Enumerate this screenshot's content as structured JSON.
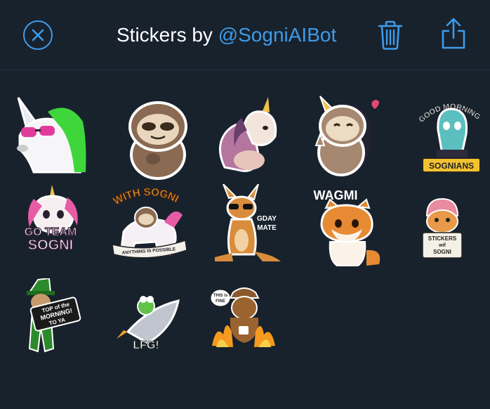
{
  "header": {
    "title_prefix": "Stickers by ",
    "title_handle": "@SogniAIBot",
    "close_icon": "close-circle-icon",
    "trash_icon": "trash-icon",
    "share_icon": "share-icon"
  },
  "colors": {
    "background": "#18222d",
    "accent": "#3e9be9",
    "divider": "#2a3646"
  },
  "stickers": [
    {
      "label": ""
    },
    {
      "label": ""
    },
    {
      "label": ""
    },
    {
      "label": ""
    },
    {
      "label_lines": [
        "GOOD MORNING",
        "SOGNIANS"
      ]
    },
    {
      "label_lines": [
        "GO TEAM",
        "SOGNI"
      ]
    },
    {
      "label_lines": [
        "WITH SOGNI",
        "ANYTHING IS POSSIBLE"
      ]
    },
    {
      "label_lines": [
        "GDAY",
        "MATE"
      ]
    },
    {
      "label_lines": [
        "WAGMI"
      ]
    },
    {
      "label_lines": [
        "STICKERS",
        "wif",
        "SOGNI"
      ]
    },
    {
      "label_lines": [
        "TOP of the",
        "MORNING!",
        "TO YA"
      ]
    },
    {
      "label_lines": [
        "LFG!"
      ]
    },
    {
      "label_lines": [
        "THIS is",
        "FINE"
      ]
    }
  ]
}
